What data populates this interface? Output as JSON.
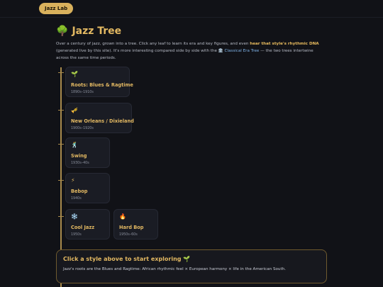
{
  "nav": {
    "pill_label": "Jazz Lab"
  },
  "header": {
    "title_icon": "🌳",
    "title": "Jazz Tree"
  },
  "intro": {
    "part1": "Over a century of jazz, grown into a tree. Click any leaf to learn its era and key figures, and even",
    "bold": "hear that style's rhythmic DNA",
    "part2": "(generated live by this site). It's more interesting compared side by side with the",
    "link_icon": "🏛️",
    "link": "Classical Era Tree",
    "part3": "— the two trees intertwine across the same time periods."
  },
  "styles": [
    {
      "icon": "🌱",
      "name": "Roots: Blues & Ragtime",
      "era": "1890s–1910s"
    },
    {
      "icon": "🎺",
      "name": "New Orleans / Dixieland",
      "era": "1900s–1920s"
    },
    {
      "icon": "🕺",
      "name": "Swing",
      "era": "1930s–40s"
    },
    {
      "icon": "⚡",
      "name": "Bebop",
      "era": "1940s"
    },
    {
      "icon": "❄️",
      "name": "Cool Jazz",
      "era": "1950s"
    },
    {
      "icon": "🔥",
      "name": "Hard Bop",
      "era": "1950s–60s"
    }
  ],
  "panel": {
    "title": "Click a style above to start exploring 🌱",
    "text": "Jazz's roots are the Blues and Ragtime: African rhythmic feel × European harmony × life in the American South."
  }
}
